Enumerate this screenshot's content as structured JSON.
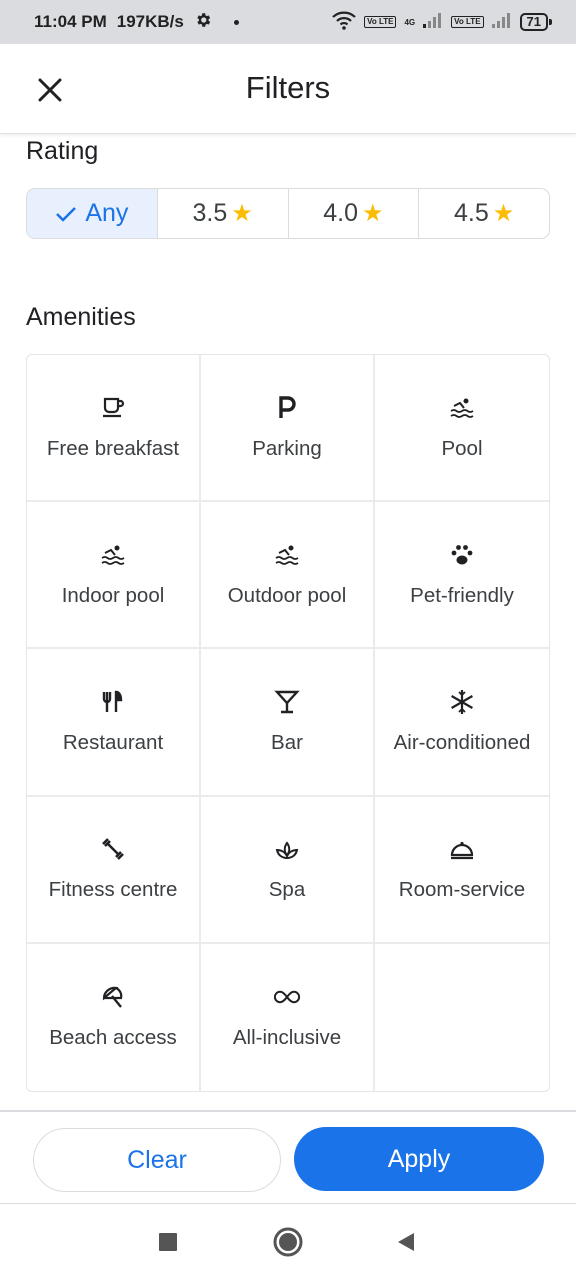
{
  "status_bar": {
    "time": "11:04 PM",
    "speed": "197KB/s",
    "network": "4G",
    "volte_1": "Vo LTE",
    "volte_2": "Vo LTE",
    "battery": "71"
  },
  "app_bar": {
    "title": "Filters",
    "close_icon": "close-icon"
  },
  "rating": {
    "title": "Rating",
    "options": [
      {
        "label": "Any",
        "selected": true,
        "icon": "check-icon"
      },
      {
        "label": "3.5",
        "selected": false,
        "icon": "star-icon"
      },
      {
        "label": "4.0",
        "selected": false,
        "icon": "star-icon"
      },
      {
        "label": "4.5",
        "selected": false,
        "icon": "star-icon"
      }
    ],
    "star_color": "#fbbc04",
    "accent_color": "#1a73e8"
  },
  "amenities": {
    "title": "Amenities",
    "items": [
      {
        "label": "Free breakfast",
        "icon": "coffee-icon"
      },
      {
        "label": "Parking",
        "icon": "parking-icon"
      },
      {
        "label": "Pool",
        "icon": "pool-icon"
      },
      {
        "label": "Indoor pool",
        "icon": "pool-icon"
      },
      {
        "label": "Outdoor pool",
        "icon": "pool-icon"
      },
      {
        "label": "Pet-friendly",
        "icon": "paw-icon"
      },
      {
        "label": "Restaurant",
        "icon": "restaurant-icon"
      },
      {
        "label": "Bar",
        "icon": "cocktail-icon"
      },
      {
        "label": "Air-conditioned",
        "icon": "snowflake-icon"
      },
      {
        "label": "Fitness centre",
        "icon": "dumbbell-icon"
      },
      {
        "label": "Spa",
        "icon": "spa-icon"
      },
      {
        "label": "Room-service",
        "icon": "room-service-icon"
      },
      {
        "label": "Beach access",
        "icon": "beach-icon"
      },
      {
        "label": "All-inclusive",
        "icon": "infinity-icon"
      }
    ]
  },
  "actions": {
    "clear_label": "Clear",
    "apply_label": "Apply",
    "apply_color": "#1a73e8"
  },
  "nav_bar": {
    "buttons": [
      "recents-icon",
      "home-icon",
      "back-icon"
    ]
  }
}
